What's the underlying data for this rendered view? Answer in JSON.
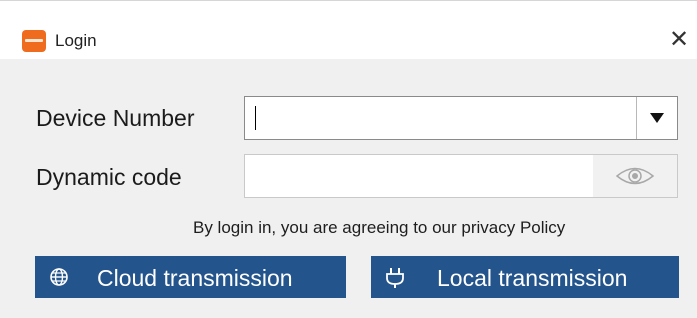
{
  "window": {
    "title": "Login",
    "close_glyph": "✕",
    "app_icon": "app-logo-icon",
    "accent_color": "#ef6c1e"
  },
  "form": {
    "device_number": {
      "label": "Device Number",
      "value": "",
      "dropdown_glyph": "▼"
    },
    "dynamic_code": {
      "label": "Dynamic code",
      "value": "",
      "toggle_icon": "eye-icon"
    },
    "privacy_text": "By login in, you are agreeing to our privacy Policy"
  },
  "actions": {
    "cloud": {
      "label": "Cloud transmission",
      "icon": "globe-icon"
    },
    "local": {
      "label": "Local transmission",
      "icon": "plug-icon"
    },
    "button_color": "#24548c"
  }
}
